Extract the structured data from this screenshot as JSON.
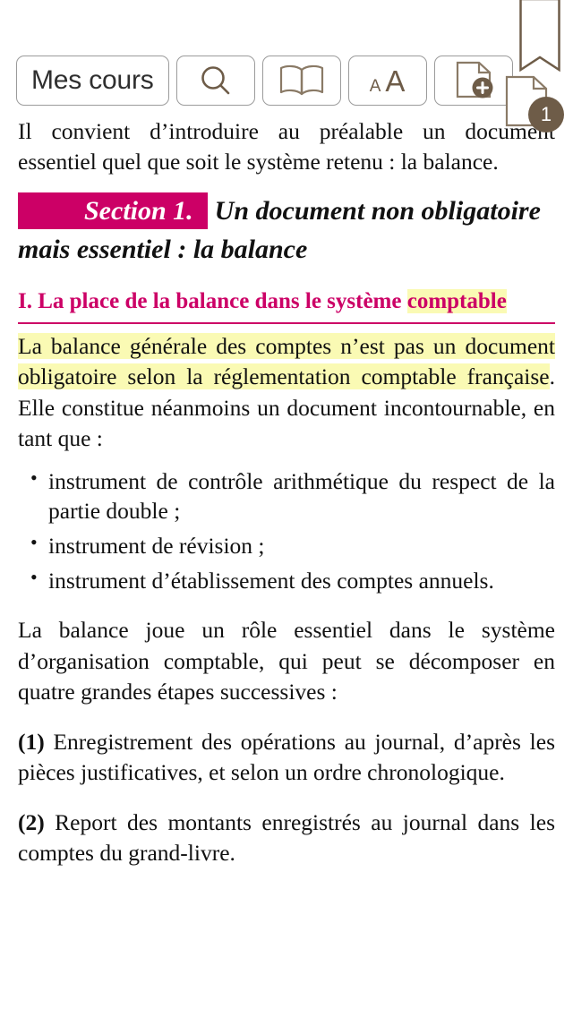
{
  "toolbar": {
    "my_courses_label": "Mes cours",
    "search_icon": "search-icon",
    "book_icon": "open-book-icon",
    "font_size_small_label": "A",
    "font_size_large_label": "A",
    "add_note_icon": "add-document-icon"
  },
  "overlay": {
    "bookmark_icon": "bookmark-ribbon-icon",
    "page_note_icon": "document-icon",
    "page_note_count": "1"
  },
  "colors": {
    "accent_magenta": "#cc0066",
    "highlight_yellow": "#fafab4",
    "icon_brown": "#6e5c48",
    "text_black": "#111111"
  },
  "content": {
    "intro_paragraph": "Il convient d’introduire au préalable un document essentiel quel que soit le système retenu : la balance.",
    "section_chip": "Section 1.",
    "section_title": "Un document non obligatoire mais essentiel : la balance",
    "sub_heading_plain": "I. La place de la balance dans le système ",
    "sub_heading_highlighted": "comptable",
    "highlighted_paragraph": "La balance générale des comptes n’est pas un document obligatoire selon la réglementation comptable française",
    "highlighted_paragraph_tail": ". Elle constitue néanmoins un document incontournable, en tant que :",
    "bullets": [
      "instrument de contrôle arithmétique du respect de la partie double ;",
      "instrument de révision ;",
      "instrument d’établissement des comptes annuels."
    ],
    "role_paragraph": "La balance joue un rôle essentiel dans le système d’organisation comptable, qui peut se décomposer en quatre grandes étapes successives :",
    "step_1_num": "(1)",
    "step_1_text": " Enregistrement des opérations au journal, d’après les pièces justificatives, et selon un ordre chronologique.",
    "step_2_num": "(2)",
    "step_2_text": " Report des montants enregistrés au journal dans les comptes du grand-livre."
  }
}
